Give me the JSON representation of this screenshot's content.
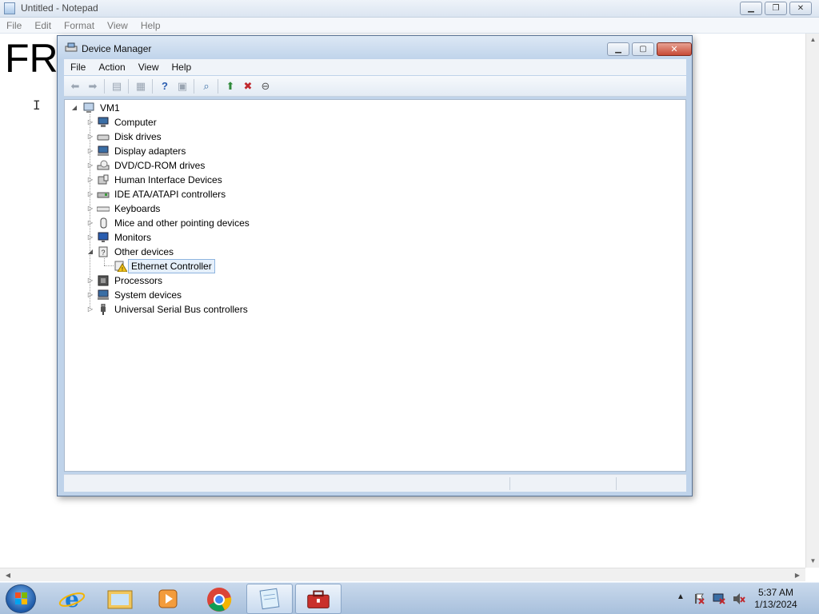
{
  "notepad": {
    "title": "Untitled - Notepad",
    "menu": [
      "File",
      "Edit",
      "Format",
      "View",
      "Help"
    ],
    "content": "FR",
    "cursor": "I"
  },
  "device_manager": {
    "title": "Device Manager",
    "menu": [
      "File",
      "Action",
      "View",
      "Help"
    ],
    "toolbar_icons": [
      "back-icon",
      "forward-icon",
      "show-hide-console-tree-icon",
      "properties-icon",
      "help-icon",
      "action-pane-icon",
      "scan-hardware-icon",
      "update-driver-icon",
      "uninstall-icon",
      "disable-icon"
    ],
    "root": "VM1",
    "categories": [
      {
        "label": "Computer",
        "icon": "computer-icon",
        "expanded": false
      },
      {
        "label": "Disk drives",
        "icon": "disk-drive-icon",
        "expanded": false
      },
      {
        "label": "Display adapters",
        "icon": "display-adapter-icon",
        "expanded": false
      },
      {
        "label": "DVD/CD-ROM drives",
        "icon": "dvd-drive-icon",
        "expanded": false
      },
      {
        "label": "Human Interface Devices",
        "icon": "hid-icon",
        "expanded": false
      },
      {
        "label": "IDE ATA/ATAPI controllers",
        "icon": "ide-controller-icon",
        "expanded": false
      },
      {
        "label": "Keyboards",
        "icon": "keyboard-icon",
        "expanded": false
      },
      {
        "label": "Mice and other pointing devices",
        "icon": "mouse-icon",
        "expanded": false
      },
      {
        "label": "Monitors",
        "icon": "monitor-icon",
        "expanded": false
      },
      {
        "label": "Other devices",
        "icon": "unknown-device-icon",
        "expanded": true,
        "children": [
          {
            "label": "Ethernet Controller",
            "icon": "warning-device-icon",
            "selected": true
          }
        ]
      },
      {
        "label": "Processors",
        "icon": "processor-icon",
        "expanded": false
      },
      {
        "label": "System devices",
        "icon": "system-device-icon",
        "expanded": false
      },
      {
        "label": "Universal Serial Bus controllers",
        "icon": "usb-icon",
        "expanded": false
      }
    ]
  },
  "taskbar": {
    "apps": [
      "internet-explorer-icon",
      "windows-explorer-icon",
      "media-player-icon",
      "chrome-icon",
      "notepad-icon",
      "device-manager-icon"
    ],
    "clock": {
      "time": "5:37 AM",
      "date": "1/13/2024"
    },
    "tray_icons": [
      "show-hidden-icons-icon",
      "action-center-icon",
      "network-icon",
      "volume-muted-icon"
    ]
  },
  "colors": {
    "selection_border": "#8fb5df",
    "selection_fill": "#e6f0fb",
    "titlebar": "#bfd3ea"
  }
}
